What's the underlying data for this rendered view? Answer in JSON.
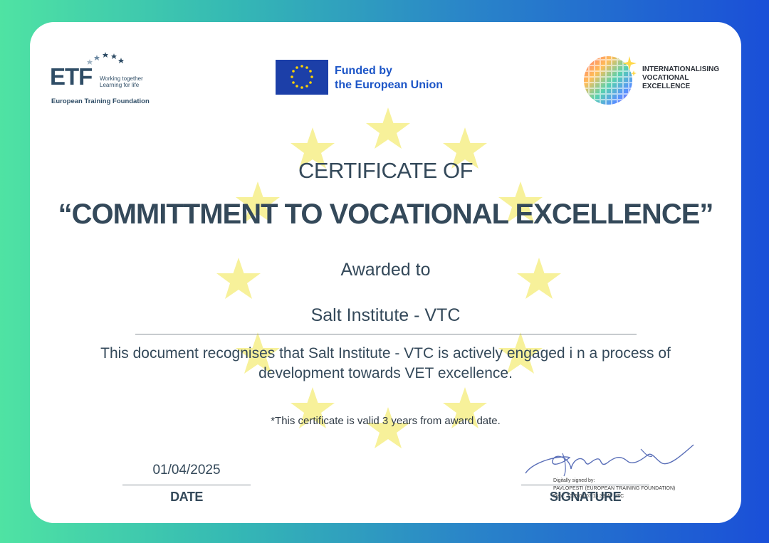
{
  "logos": {
    "etf": {
      "letters": "ETF",
      "tagline_line1": "Working together",
      "tagline_line2": "Learning for life",
      "name": "European Training Foundation"
    },
    "eu": {
      "line1": "Funded by",
      "line2": "the European Union"
    },
    "ive": {
      "line1": "INTERNATIONALISING",
      "line2": "VOCATIONAL",
      "line3": "EXCELLENCE"
    }
  },
  "certificate": {
    "heading": "CERTIFICATE OF",
    "title": "“COMMITTMENT TO VOCATIONAL EXCELLENCE”",
    "awarded_to": "Awarded to",
    "recipient": "Salt Institute - VTC",
    "description_line1": "This document recognises that Salt Institute - VTC is actively engaged i n a process of",
    "description_line2": "development towards VET excellence.",
    "validity_note": "*This certificate is valid 3 years from award date."
  },
  "footer": {
    "date_value": "01/04/2025",
    "date_label": "DATE",
    "signature_label": "SIGNATURE",
    "digital_sig_line1": "Digitally signed by:",
    "digital_sig_line2": "PAVLOPESTI (EUROPEAN TRAINING FOUNDATION)",
    "digital_sig_line3": "Date: 2025.04.07 13:39:49 UTC"
  },
  "colors": {
    "text": "#34495a",
    "star": "#f7f19a",
    "eu_blue": "#1c3fa8",
    "eu_text": "#1c55c7",
    "etf_blue": "#2f4d66"
  }
}
